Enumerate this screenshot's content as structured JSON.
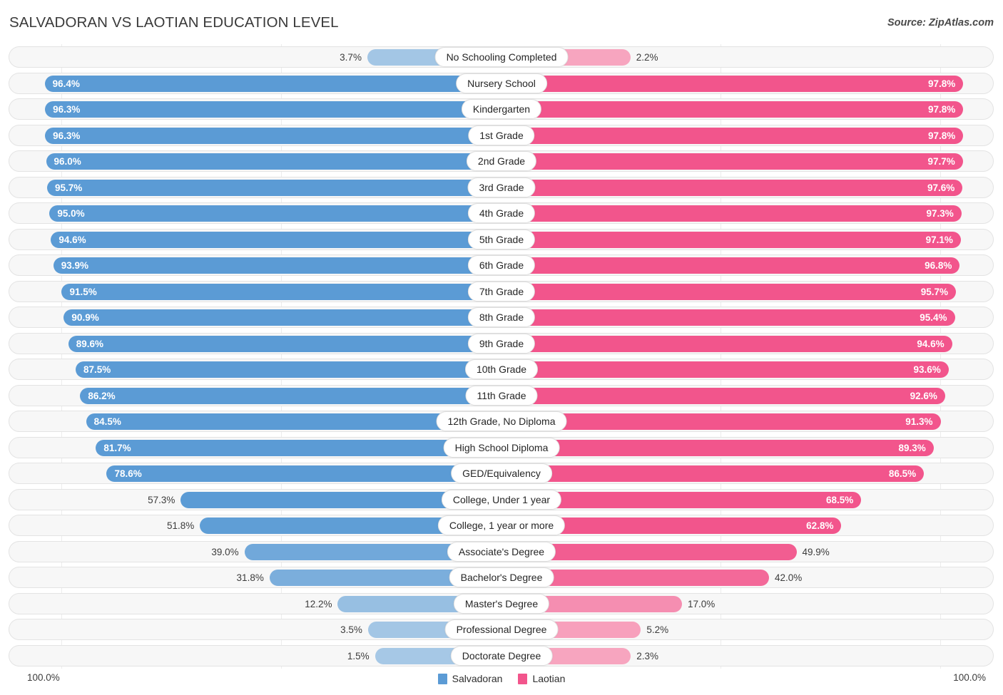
{
  "header": {
    "title": "SALVADORAN VS LAOTIAN EDUCATION LEVEL",
    "source": "Source: ZipAtlas.com"
  },
  "legend": {
    "left": {
      "label": "Salvadoran",
      "color": "#5b9bd5"
    },
    "right": {
      "label": "Laotian",
      "color": "#f2558c"
    }
  },
  "axis": {
    "left_max": "100.0%",
    "right_max": "100.0%"
  },
  "chart_data": {
    "type": "bar",
    "orientation": "horizontal-diverging",
    "title": "SALVADORAN VS LAOTIAN EDUCATION LEVEL",
    "xlabel": "",
    "ylabel": "",
    "xlim": [
      0,
      100
    ],
    "grid": false,
    "legend_position": "bottom-center",
    "categories": [
      "No Schooling Completed",
      "Nursery School",
      "Kindergarten",
      "1st Grade",
      "2nd Grade",
      "3rd Grade",
      "4th Grade",
      "5th Grade",
      "6th Grade",
      "7th Grade",
      "8th Grade",
      "9th Grade",
      "10th Grade",
      "11th Grade",
      "12th Grade, No Diploma",
      "High School Diploma",
      "GED/Equivalency",
      "College, Under 1 year",
      "College, 1 year or more",
      "Associate's Degree",
      "Bachelor's Degree",
      "Master's Degree",
      "Professional Degree",
      "Doctorate Degree"
    ],
    "series": [
      {
        "name": "Salvadoran",
        "side": "left",
        "color": "#5b9bd5",
        "values": [
          3.7,
          96.4,
          96.3,
          96.3,
          96.0,
          95.7,
          95.0,
          94.6,
          93.9,
          91.5,
          90.9,
          89.6,
          87.5,
          86.2,
          84.5,
          81.7,
          78.6,
          57.3,
          51.8,
          39.0,
          31.8,
          12.2,
          3.5,
          1.5
        ],
        "labels": [
          "3.7%",
          "96.4%",
          "96.3%",
          "96.3%",
          "96.0%",
          "95.7%",
          "95.0%",
          "94.6%",
          "93.9%",
          "91.5%",
          "90.9%",
          "89.6%",
          "87.5%",
          "86.2%",
          "84.5%",
          "81.7%",
          "78.6%",
          "57.3%",
          "51.8%",
          "39.0%",
          "31.8%",
          "12.2%",
          "3.5%",
          "1.5%"
        ]
      },
      {
        "name": "Laotian",
        "side": "right",
        "color": "#f2558c",
        "values": [
          2.2,
          97.8,
          97.8,
          97.8,
          97.7,
          97.6,
          97.3,
          97.1,
          96.8,
          95.7,
          95.4,
          94.6,
          93.6,
          92.6,
          91.3,
          89.3,
          86.5,
          68.5,
          62.8,
          49.9,
          42.0,
          17.0,
          5.2,
          2.3
        ],
        "labels": [
          "2.2%",
          "97.8%",
          "97.8%",
          "97.8%",
          "97.7%",
          "97.6%",
          "97.3%",
          "97.1%",
          "96.8%",
          "95.7%",
          "95.4%",
          "94.6%",
          "93.6%",
          "92.6%",
          "91.3%",
          "89.3%",
          "86.5%",
          "68.5%",
          "62.8%",
          "49.9%",
          "42.0%",
          "17.0%",
          "5.2%",
          "2.3%"
        ]
      }
    ]
  }
}
